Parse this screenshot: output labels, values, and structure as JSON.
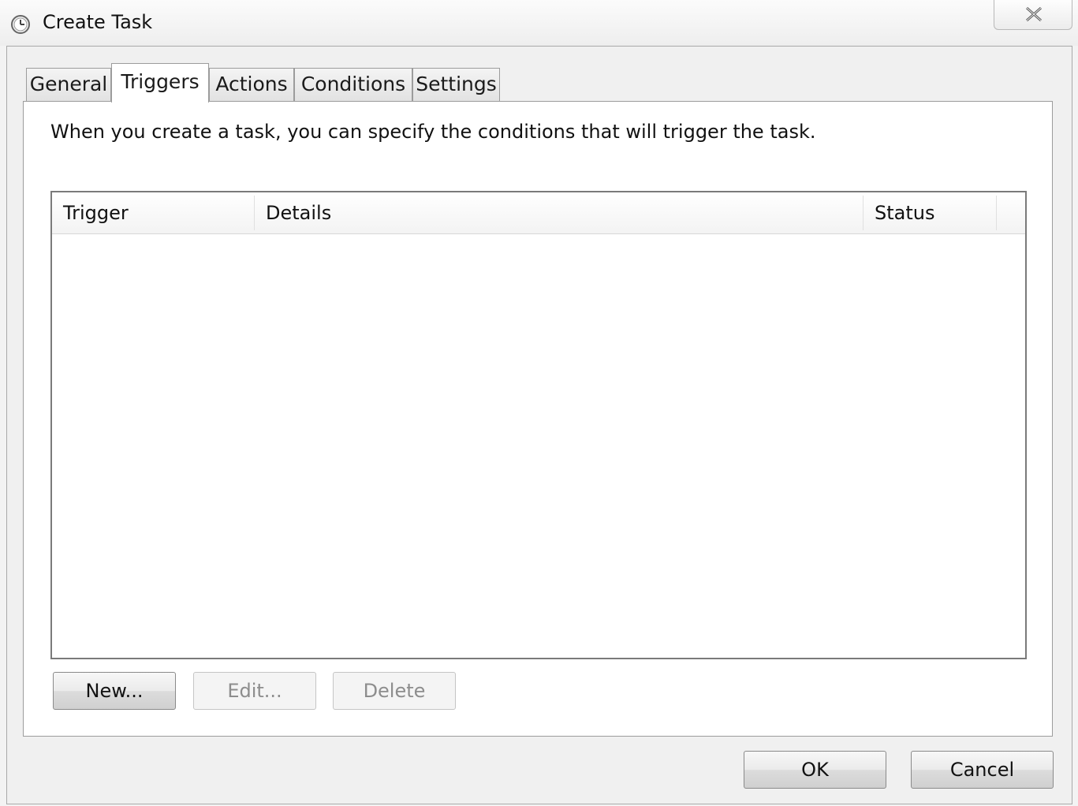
{
  "window": {
    "title": "Create Task",
    "title_icon": "clock-icon",
    "close_icon": "close-icon"
  },
  "tabs": [
    {
      "label": "General",
      "active": false
    },
    {
      "label": "Triggers",
      "active": true
    },
    {
      "label": "Actions",
      "active": false
    },
    {
      "label": "Conditions",
      "active": false
    },
    {
      "label": "Settings",
      "active": false
    }
  ],
  "triggers_tab": {
    "description": "When you create a task, you can specify the conditions that will trigger the task.",
    "table": {
      "columns": [
        "Trigger",
        "Details",
        "Status"
      ],
      "rows": []
    },
    "buttons": {
      "new": {
        "label": "New...",
        "enabled": true
      },
      "edit": {
        "label": "Edit...",
        "enabled": false
      },
      "delete": {
        "label": "Delete",
        "enabled": false
      }
    }
  },
  "dialog_buttons": {
    "ok": "OK",
    "cancel": "Cancel"
  }
}
